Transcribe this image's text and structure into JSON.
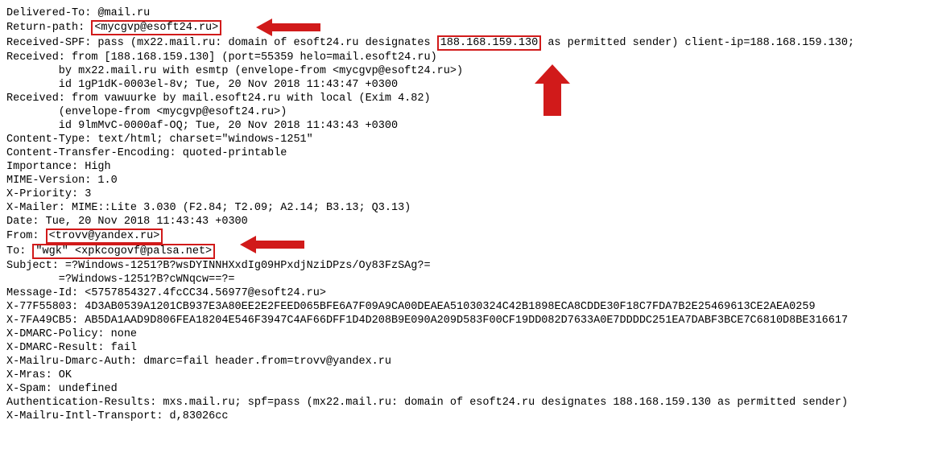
{
  "headers": {
    "delivered_to": {
      "label": "Delivered-To:",
      "value": "       @mail.ru"
    },
    "return_path": {
      "label": "Return-path:",
      "box": "<mycgvp@esoft24.ru>"
    },
    "received_spf": {
      "pre": "Received-SPF: pass (mx22.mail.ru: domain of esoft24.ru designates ",
      "box": "188.168.159.130",
      "post": " as permitted sender) client-ip=188.168.159.130;"
    },
    "received1_l1": "Received: from [188.168.159.130] (port=55359 helo=mail.esoft24.ru)",
    "received1_l2": "by mx22.mail.ru with esmtp (envelope-from <mycgvp@esoft24.ru>)",
    "received1_l3": "id 1gP1dK-0003el-8v; Tue, 20 Nov 2018 11:43:47 +0300",
    "received2_l1": "Received: from vawuurke by mail.esoft24.ru with local (Exim 4.82)",
    "received2_l2": "(envelope-from <mycgvp@esoft24.ru>)",
    "received2_l3": "id 9lmMvC-0000af-OQ; Tue, 20 Nov 2018 11:43:43 +0300",
    "content_type": "Content-Type: text/html; charset=\"windows-1251\"",
    "cte": "Content-Transfer-Encoding: quoted-printable",
    "importance": "Importance: High",
    "mime": "MIME-Version: 1.0",
    "xpriority": "X-Priority: 3",
    "xmailer": "X-Mailer: MIME::Lite 3.030 (F2.84; T2.09; A2.14; B3.13; Q3.13)",
    "date": "Date: Tue, 20 Nov 2018 11:43:43 +0300",
    "from": {
      "label": "From: ",
      "box": "<trovv@yandex.ru>"
    },
    "to": {
      "label": "To: ",
      "box": "\"wgk\" <xpkcogovf@palsa.net>"
    },
    "subject_l1": "Subject: =?Windows-1251?B?wsDYINNHXxdIg09HPxdjNziDPzs/Oy83FzSAg?=",
    "subject_l2": "=?Windows-1251?B?cWNqcw==?=",
    "message_id": "Message-Id: <5757854327.4fcCC34.56977@esoft24.ru>",
    "x77": "X-77F55803: 4D3AB0539A1201CB937E3A80EE2E2FEED065BFE6A7F09A9CA00DEAEA51030324C42B1898ECA8CDDE30F18C7FDA7B2E25469613CE2AEA0259",
    "x7f": "X-7FA49CB5: AB5DA1AAD9D806FEA18204E546F3947C4AF66DFF1D4D208B9E090A209D583F00CF19DD082D7633A0E7DDDDC251EA7DABF3BCE7C6810D8BE316617",
    "dmarc_policy": "X-DMARC-Policy: none",
    "dmarc_result": "X-DMARC-Result: fail",
    "mailru_dmarc": "X-Mailru-Dmarc-Auth: dmarc=fail header.from=trovv@yandex.ru",
    "mras": "X-Mras: OK",
    "xspam": "X-Spam: undefined",
    "auth_results": "Authentication-Results: mxs.mail.ru; spf=pass (mx22.mail.ru: domain of esoft24.ru designates 188.168.159.130 as permitted sender)",
    "intl_transport": "X-Mailru-Intl-Transport: d,83026cc"
  },
  "annotations": {
    "arrow_left_1": "arrow-left",
    "arrow_left_2": "arrow-left",
    "arrow_up": "arrow-up"
  }
}
